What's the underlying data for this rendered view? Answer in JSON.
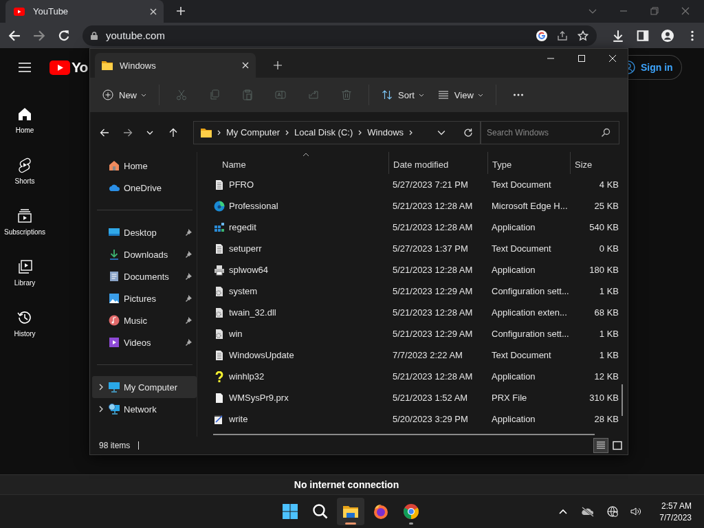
{
  "browser": {
    "tab": {
      "title": "YouTube"
    },
    "address": "youtube.com"
  },
  "youtube": {
    "logo_text": "Yo",
    "sign_in": "Sign in",
    "banner": "No internet connection",
    "nav": [
      {
        "label": "Home",
        "kind": "home"
      },
      {
        "label": "Shorts",
        "kind": "shorts"
      },
      {
        "label": "Subscriptions",
        "kind": "subscriptions"
      },
      {
        "label": "Library",
        "kind": "library"
      },
      {
        "label": "History",
        "kind": "history"
      }
    ]
  },
  "explorer": {
    "tab_title": "Windows",
    "commands": [
      {
        "kind": "new",
        "label": "New",
        "disabled": false
      },
      {
        "kind": "cut",
        "disabled": true
      },
      {
        "kind": "copy",
        "disabled": true
      },
      {
        "kind": "paste",
        "disabled": true
      },
      {
        "kind": "rename",
        "disabled": true
      },
      {
        "kind": "share",
        "disabled": true
      },
      {
        "kind": "delete",
        "disabled": true
      },
      {
        "kind": "sort",
        "label": "Sort",
        "disabled": false
      },
      {
        "kind": "view",
        "label": "View",
        "disabled": false
      },
      {
        "kind": "more",
        "disabled": false
      }
    ],
    "breadcrumb": [
      "My Computer",
      "Local Disk (C:)",
      "Windows"
    ],
    "search": {
      "placeholder": "Search Windows"
    },
    "nav_groups": [
      [
        {
          "label": "Home",
          "kind": "home",
          "selected": false
        },
        {
          "label": "OneDrive",
          "kind": "cloud",
          "selected": false
        }
      ],
      [
        {
          "label": "Desktop",
          "kind": "desktop",
          "selected": false,
          "pinned": true
        },
        {
          "label": "Downloads",
          "kind": "downloads",
          "selected": false,
          "pinned": true
        },
        {
          "label": "Documents",
          "kind": "documents",
          "selected": false,
          "pinned": true
        },
        {
          "label": "Pictures",
          "kind": "pictures",
          "selected": false,
          "pinned": true
        },
        {
          "label": "Music",
          "kind": "music",
          "selected": false,
          "pinned": true
        },
        {
          "label": "Videos",
          "kind": "videos",
          "selected": false,
          "pinned": true
        }
      ],
      [
        {
          "label": "My Computer",
          "kind": "computer",
          "selected": true,
          "expanded": false
        },
        {
          "label": "Network",
          "kind": "network",
          "selected": false,
          "expanded": false
        }
      ]
    ],
    "columns": [
      {
        "label": "Name",
        "sorted": true
      },
      {
        "label": "Date modified",
        "sorted": false
      },
      {
        "label": "Type",
        "sorted": false
      },
      {
        "label": "Size",
        "sorted": false
      }
    ],
    "files": [
      {
        "name": "PFRO",
        "date": "5/27/2023 7:21 PM",
        "type": "Text Document",
        "size": "4 KB",
        "kind": "text"
      },
      {
        "name": "Professional",
        "date": "5/21/2023 12:28 AM",
        "type": "Microsoft Edge H...",
        "size": "25 KB",
        "kind": "edge"
      },
      {
        "name": "regedit",
        "date": "5/21/2023 12:28 AM",
        "type": "Application",
        "size": "540 KB",
        "kind": "regedit"
      },
      {
        "name": "setuperr",
        "date": "5/27/2023 1:37 PM",
        "type": "Text Document",
        "size": "0 KB",
        "kind": "text"
      },
      {
        "name": "splwow64",
        "date": "5/21/2023 12:28 AM",
        "type": "Application",
        "size": "180 KB",
        "kind": "printer"
      },
      {
        "name": "system",
        "date": "5/21/2023 12:29 AM",
        "type": "Configuration sett...",
        "size": "1 KB",
        "kind": "config"
      },
      {
        "name": "twain_32.dll",
        "date": "5/21/2023 12:28 AM",
        "type": "Application exten...",
        "size": "68 KB",
        "kind": "config"
      },
      {
        "name": "win",
        "date": "5/21/2023 12:29 AM",
        "type": "Configuration sett...",
        "size": "1 KB",
        "kind": "config"
      },
      {
        "name": "WindowsUpdate",
        "date": "7/7/2023 2:22 AM",
        "type": "Text Document",
        "size": "1 KB",
        "kind": "text"
      },
      {
        "name": "winhlp32",
        "date": "5/21/2023 12:28 AM",
        "type": "Application",
        "size": "12 KB",
        "kind": "help"
      },
      {
        "name": "WMSysPr9.prx",
        "date": "5/21/2023 1:52 AM",
        "type": "PRX File",
        "size": "310 KB",
        "kind": "blank"
      },
      {
        "name": "write",
        "date": "5/20/2023 3:29 PM",
        "type": "Application",
        "size": "28 KB",
        "kind": "write"
      }
    ],
    "status": "98 items",
    "views": [
      {
        "kind": "details",
        "selected": true
      },
      {
        "kind": "tiles",
        "selected": false
      }
    ]
  },
  "taskbar": {
    "apps": [
      {
        "kind": "start",
        "selected": false,
        "running": false
      },
      {
        "kind": "search",
        "selected": false,
        "running": false
      },
      {
        "kind": "explorer",
        "selected": true,
        "running": true
      },
      {
        "kind": "firefox",
        "selected": false,
        "running": false
      },
      {
        "kind": "chrome",
        "selected": false,
        "running": true
      }
    ],
    "time": "2:57 AM",
    "date": "7/7/2023"
  }
}
